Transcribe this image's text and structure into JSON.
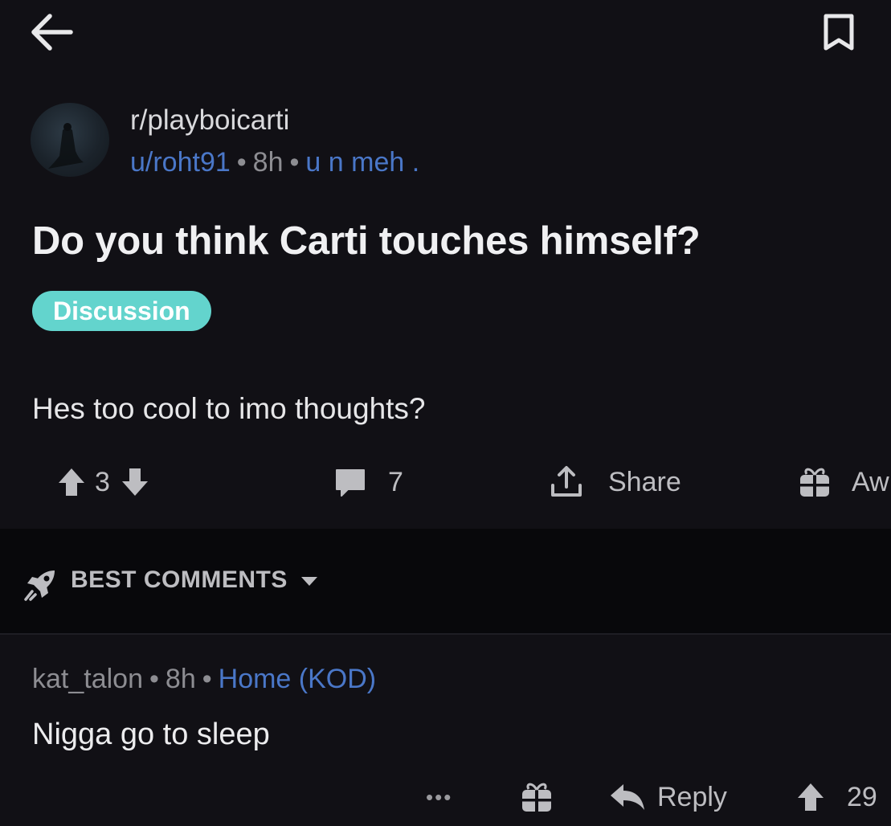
{
  "post": {
    "subreddit": "r/playboicarti",
    "author": "u/roht91",
    "age": "8h",
    "flair_text": "u n meh .",
    "title": "Do you think Carti touches himself?",
    "flair_badge": "Discussion",
    "body": "Hes too cool to imo thoughts?",
    "score": "3",
    "comments_count": "7",
    "share_label": "Share",
    "award_label": "Aw"
  },
  "sort": {
    "label": "BEST COMMENTS"
  },
  "comment": {
    "author": "kat_talon",
    "age": "8h",
    "flair": "Home (KOD)",
    "body": "Nigga go to sleep",
    "more_label": "•••",
    "reply_label": "Reply",
    "score": "29"
  },
  "colors": {
    "background": "#111015",
    "accent_blue": "#4a77c8",
    "flair_teal": "#63d4cd",
    "sort_bar": "#08080b"
  },
  "icons": [
    "back-arrow-icon",
    "bookmark-icon",
    "upvote-icon",
    "downvote-icon",
    "comment-icon",
    "share-icon",
    "gift-icon",
    "rocket-icon",
    "chevron-down-icon",
    "reply-icon"
  ]
}
